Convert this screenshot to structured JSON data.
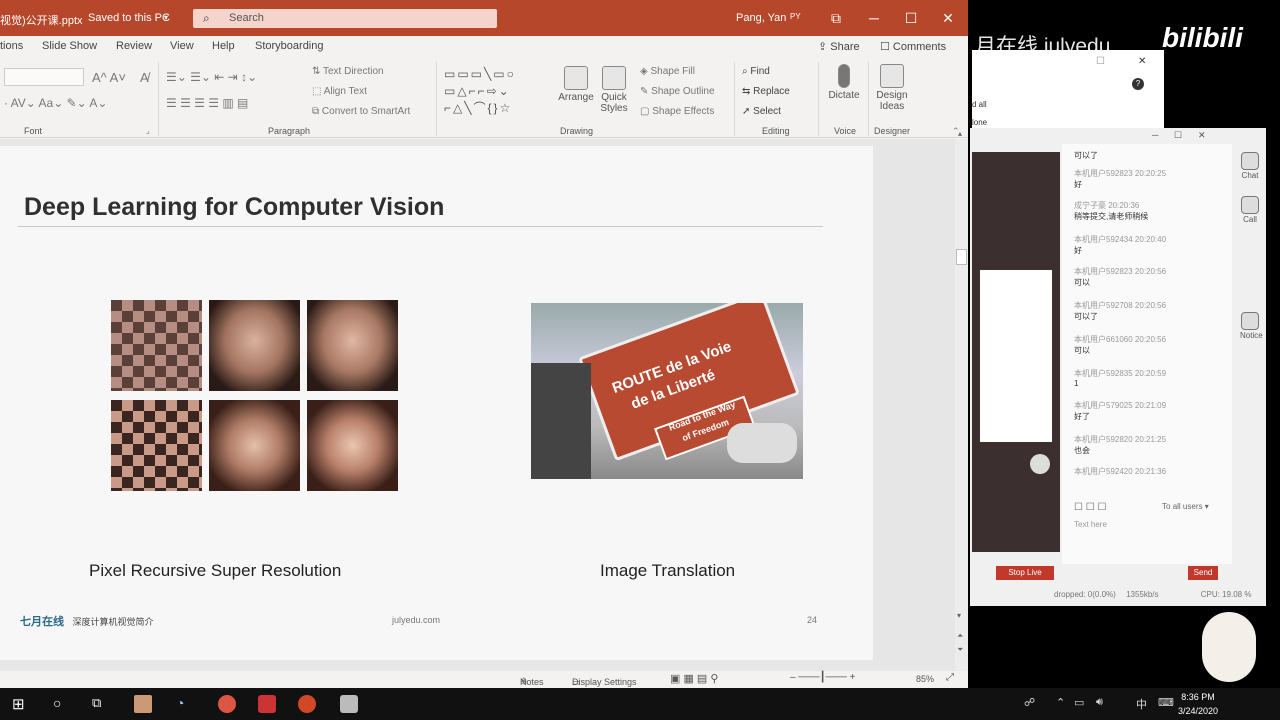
{
  "window": {
    "file_name": "视觉)公开课.pptx",
    "save_status": "Saved to this PC",
    "search_placeholder": "Search",
    "user_name": "Pang, Yan",
    "user_initials": "PY"
  },
  "tabs": [
    "tions",
    "Slide Show",
    "Review",
    "View",
    "Help",
    "Storyboarding"
  ],
  "share_label": "Share",
  "comments_label": "Comments",
  "ribbon": {
    "font_label": "Font",
    "paragraph_label": "Paragraph",
    "text_direction": "Text Direction",
    "align_text": "Align Text",
    "convert_smartart": "Convert to SmartArt",
    "arrange": "Arrange",
    "quick_styles": "Quick Styles",
    "shape_fill": "Shape Fill",
    "shape_outline": "Shape Outline",
    "shape_effects": "Shape Effects",
    "drawing_label": "Drawing",
    "find": "Find",
    "replace": "Replace",
    "select": "Select",
    "editing_label": "Editing",
    "dictate": "Dictate",
    "voice_label": "Voice",
    "design_ideas": "Design Ideas",
    "designer_label": "Designer"
  },
  "slide": {
    "title": "Deep Learning for Computer Vision",
    "left_caption": "Pixel Recursive Super Resolution",
    "right_caption": "Image Translation",
    "sign_line1": "ROUTE de la Voie",
    "sign_line2": "de la Liberté",
    "sign_small1": "Road to the Way",
    "sign_small2": "of Freedom",
    "footer_logo": "七月在线",
    "footer_subtitle": "深度计算机视觉简介",
    "footer_site": "julyedu.com",
    "page_number": "24"
  },
  "statusbar": {
    "notes": "Notes",
    "display_settings": "Display Settings",
    "zoom": "85%"
  },
  "stream": {
    "watermark": "月在线 julyedu",
    "brand": "bilibili",
    "chat": [
      {
        "user": "",
        "msg": "可以了"
      },
      {
        "user": "本机用户592823  20:20:25",
        "msg": "好"
      },
      {
        "user": "成宁子豪  20:20:36",
        "msg": "稍等提交,请老师稍候"
      },
      {
        "user": "本机用户592434  20:20:40",
        "msg": "好"
      },
      {
        "user": "本机用户592823  20:20:56",
        "msg": "可以"
      },
      {
        "user": "本机用户592708  20:20:56",
        "msg": "可以了"
      },
      {
        "user": "本机用户661060  20:20:56",
        "msg": "可以"
      },
      {
        "user": "本机用户592835  20:20:59",
        "msg": "1"
      },
      {
        "user": "本机用户579025  20:21:09",
        "msg": "好了"
      },
      {
        "user": "本机用户592820  20:21:25",
        "msg": "也会"
      },
      {
        "user": "本机用户592420  20:21:36",
        "msg": ""
      }
    ],
    "side_chat": "Chat",
    "side_call": "Call",
    "side_notice": "Notice",
    "to_label": "To",
    "to_value": "all users",
    "text_placeholder": "Text here",
    "stop_live": "Stop Live",
    "send": "Send",
    "dropped": "dropped: 0(0.0%)",
    "bitrate": "1355kb/s",
    "cpu": "CPU: 19.08 %",
    "popup_text": "d all",
    "popup_text2": "lone"
  },
  "taskbar": {
    "time": "8:36 PM",
    "date": "3/24/2020",
    "ime": "中"
  }
}
